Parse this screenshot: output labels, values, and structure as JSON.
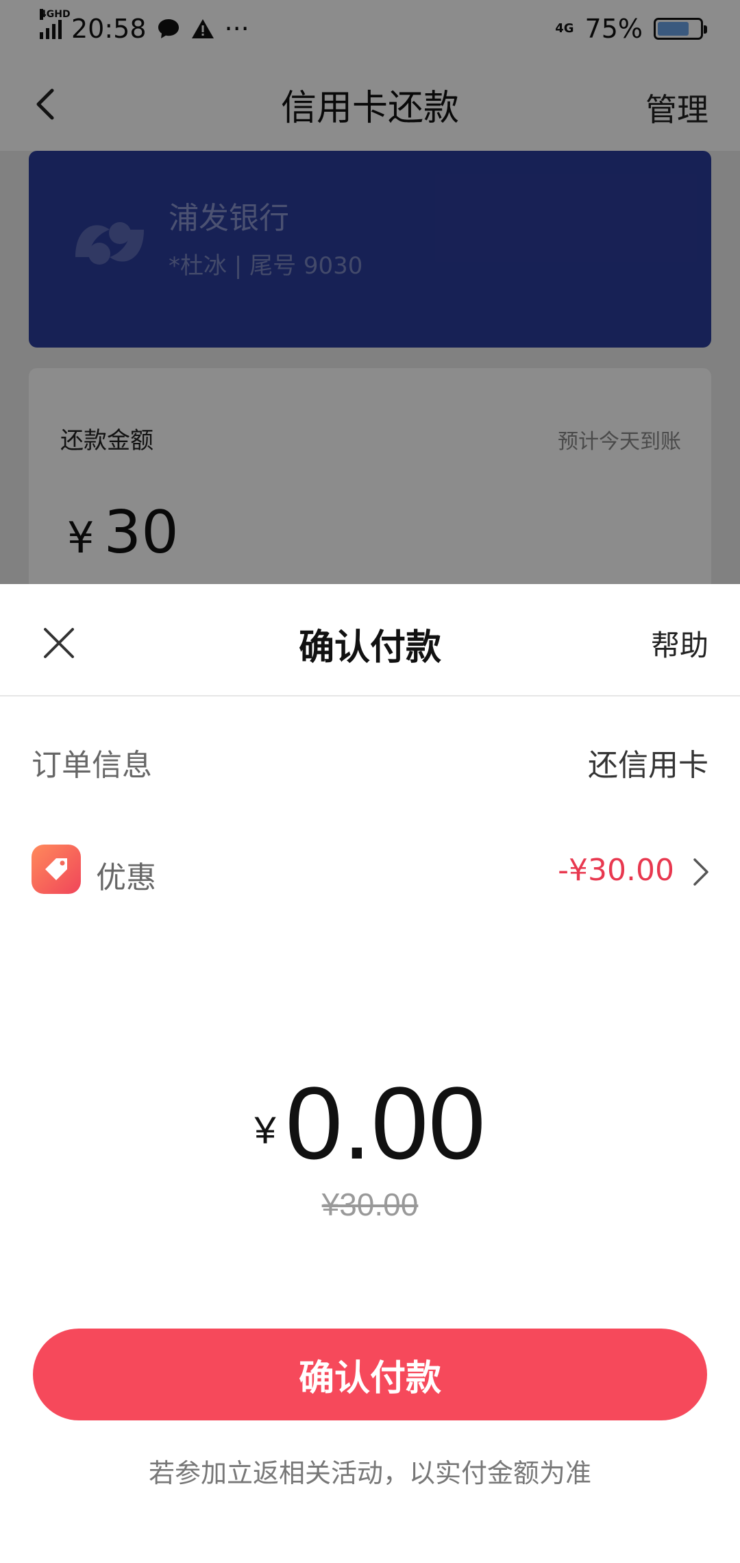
{
  "status_bar": {
    "network": "4GHD",
    "time": "20:58",
    "net_right": "4G",
    "battery": "75%"
  },
  "page": {
    "title": "信用卡还款",
    "manage_label": "管理",
    "bank_card": {
      "bank_name": "浦发银行",
      "holder_info": "*杜冰 | 尾号 9030"
    },
    "amount_card": {
      "label": "还款金额",
      "eta": "预计今天到账",
      "currency": "¥",
      "amount": "30"
    }
  },
  "sheet": {
    "title": "确认付款",
    "help_label": "帮助",
    "order_label": "订单信息",
    "order_value": "还信用卡",
    "discount_label": "优惠",
    "discount_value": "-¥30.00",
    "total_currency": "¥",
    "total_amount": "0.00",
    "original_amount": "¥30.00",
    "confirm_label": "确认付款",
    "footnote": "若参加立返相关活动，以实付金额为准"
  },
  "colors": {
    "accent": "#f6495b",
    "discount": "#e8384f",
    "bank_card": "#2b3d9b"
  },
  "icons": [
    "signal-icon",
    "wechat-icon",
    "warning-icon",
    "battery-icon",
    "back-icon",
    "bank-logo-icon",
    "close-icon",
    "coupon-tag-icon",
    "chevron-right-icon"
  ]
}
